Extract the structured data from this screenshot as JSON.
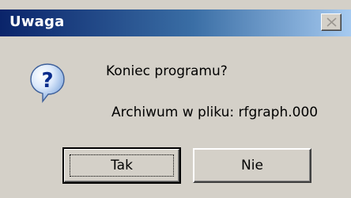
{
  "window": {
    "title": "Uwaga",
    "close_icon": "close-icon"
  },
  "message": {
    "icon": "question-icon",
    "line1": "Koniec programu?",
    "line2": "Archiwum w pliku: rfgraph.000"
  },
  "buttons": {
    "yes_label": "Tak",
    "no_label": "Nie"
  },
  "colors": {
    "title_bar_start": "#0a246a",
    "title_bar_end": "#a6caf0",
    "dialog_background": "#d4d0c8"
  }
}
